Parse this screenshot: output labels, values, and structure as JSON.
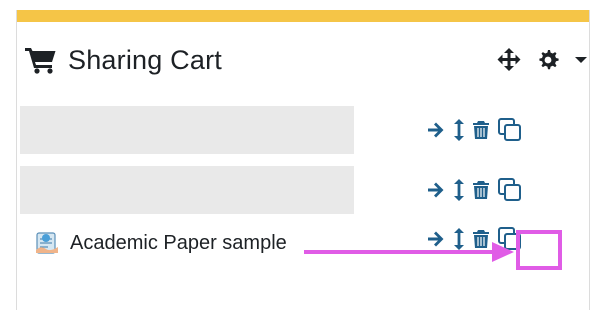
{
  "block": {
    "title": "Sharing Cart",
    "accent_color": "#f5c547"
  },
  "header_controls": {
    "move_icon": "move-arrows-icon",
    "settings_icon": "gear-icon",
    "menu_icon": "caret-down-icon"
  },
  "items": [
    {
      "type": "placeholder",
      "name": ""
    },
    {
      "type": "placeholder",
      "name": ""
    },
    {
      "type": "item",
      "name": "Academic Paper sample",
      "icon": "assignment-icon"
    }
  ],
  "item_actions": [
    "arrow-right-icon",
    "move-vertical-icon",
    "trash-icon",
    "copy-icon"
  ],
  "colors": {
    "action": "#1f5f8b",
    "annotation": "#e05ce6"
  }
}
